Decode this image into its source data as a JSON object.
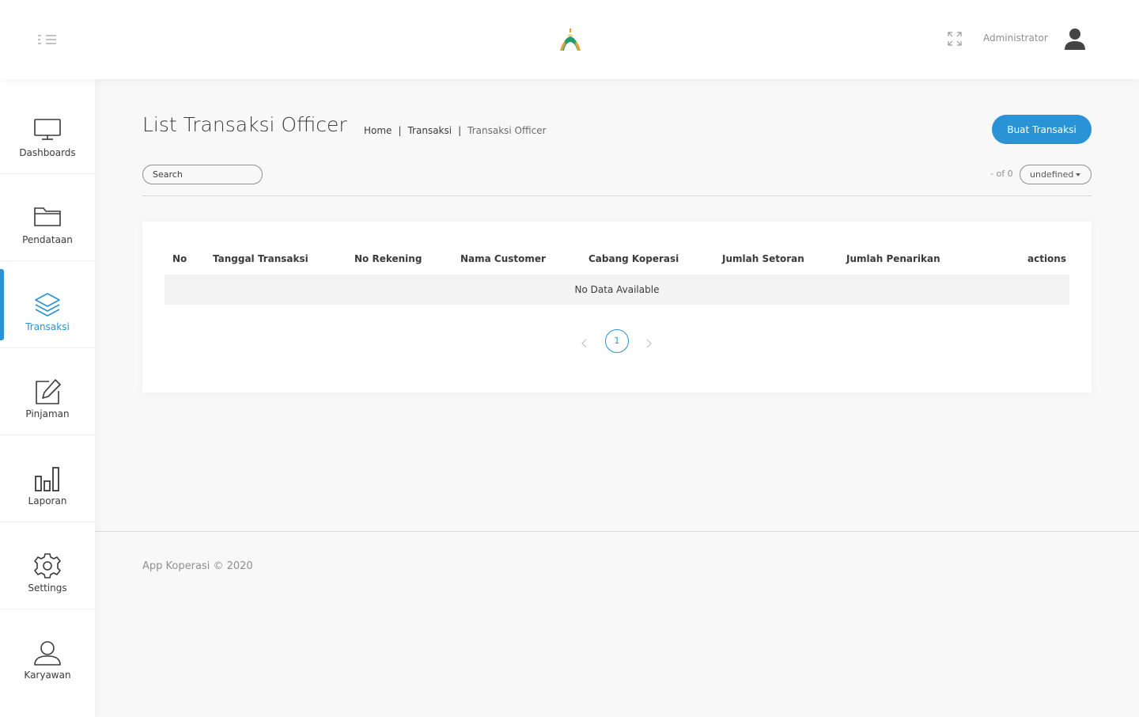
{
  "header": {
    "username": "Administrator",
    "colors": {
      "accent": "#2a93d5"
    }
  },
  "sidebar": {
    "items": [
      {
        "label": "Dashboards",
        "icon": "monitor-icon"
      },
      {
        "label": "Pendataan",
        "icon": "folder-icon"
      },
      {
        "label": "Transaksi",
        "icon": "layers-icon",
        "active": true
      },
      {
        "label": "Pinjaman",
        "icon": "edit-icon"
      },
      {
        "label": "Laporan",
        "icon": "bar-chart-icon"
      },
      {
        "label": "Settings",
        "icon": "gear-icon"
      },
      {
        "label": "Karyawan",
        "icon": "user-icon"
      }
    ]
  },
  "page": {
    "title": "List Transaksi Officer",
    "breadcrumb": [
      "Home",
      "Transaksi",
      "Transaksi Officer"
    ],
    "create_button": "Buat Transaksi"
  },
  "toolbar": {
    "search_placeholder": "Search",
    "page_count": "- of 0",
    "page_size": "undefined"
  },
  "table": {
    "columns": [
      "No",
      "Tanggal Transaksi",
      "No Rekening",
      "Nama Customer",
      "Cabang Koperasi",
      "Jumlah Setoran",
      "Jumlah Penarikan",
      "actions"
    ],
    "empty_text": "No Data Available"
  },
  "pagination": {
    "current_page": "1"
  },
  "footer": {
    "text": "App Koperasi © 2020"
  }
}
